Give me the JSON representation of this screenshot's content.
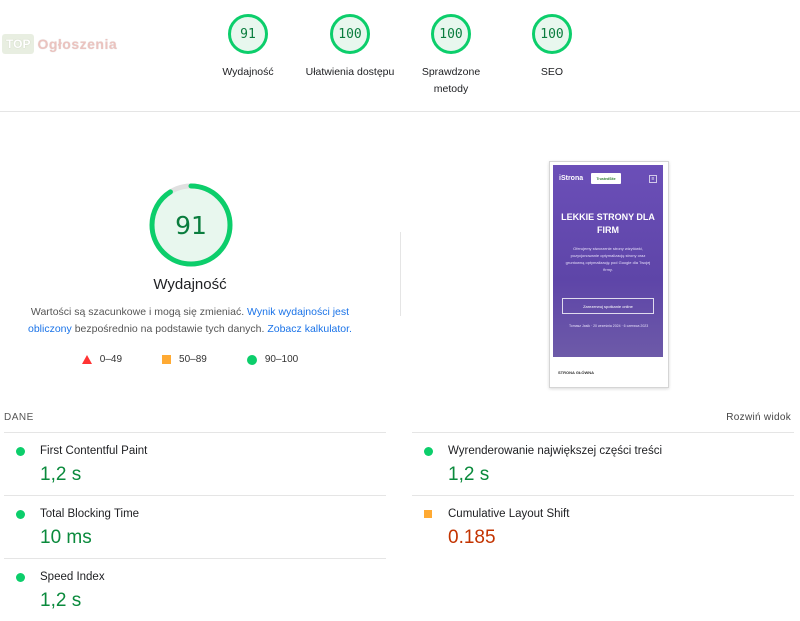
{
  "logo": {
    "badge": "TOP",
    "text": "Ogłoszenia"
  },
  "top_gauges": [
    {
      "score": "91",
      "label": "Wydajność"
    },
    {
      "score": "100",
      "label": "Ułatwienia dostępu"
    },
    {
      "score": "100",
      "label": "Sprawdzone metody",
      "line1": "Sprawdzone",
      "line2": "metody"
    },
    {
      "score": "100",
      "label": "SEO"
    }
  ],
  "main": {
    "score": "91",
    "score_fraction": 0.91,
    "label": "Wydajność",
    "desc_pre": "Wartości są szacunkowe i mogą się zmieniać.",
    "desc_link1": "Wynik wydajności jest obliczony",
    "desc_mid": "bezpośrednio na podstawie tych danych.",
    "desc_link2": "Zobacz kalkulator."
  },
  "legend": [
    {
      "shape": "triangle-red",
      "range": "0–49"
    },
    {
      "shape": "square-orange",
      "range": "50–89"
    },
    {
      "shape": "circle-green",
      "range": "90–100"
    }
  ],
  "phone": {
    "brand": "iStrona",
    "badge": "TrustedSite",
    "title": "LEKKIE STRONY DLA FIRM",
    "text": "Oferujemy stworzenie strony wizytówki, pozycjonowanie optymalizację strony oraz gruntowną optymalizację pod Google dla Twojej firmy.",
    "button": "Zarezerwuj spotkanie online",
    "meta": "Tomasz Jasik · 20 września 2024 · 6 czerwca 2023",
    "footer": "STRONA GŁÓWNA"
  },
  "section": {
    "title": "DANE",
    "expand": "Rozwiń widok"
  },
  "metrics_left": [
    {
      "name": "First Contentful Paint",
      "value": "1,2 s",
      "status": "good"
    },
    {
      "name": "Total Blocking Time",
      "value": "10 ms",
      "status": "good"
    },
    {
      "name": "Speed Index",
      "value": "1,2 s",
      "status": "good"
    }
  ],
  "metrics_right": [
    {
      "name": "Wyrenderowanie największej części treści",
      "value": "1,2 s",
      "status": "good"
    },
    {
      "name": "Cumulative Layout Shift",
      "value": "0.185",
      "status": "average"
    }
  ],
  "colors": {
    "good": "#0cce6b",
    "average": "#ffaa33",
    "poor": "#ff3333",
    "link": "#1a73e8"
  }
}
